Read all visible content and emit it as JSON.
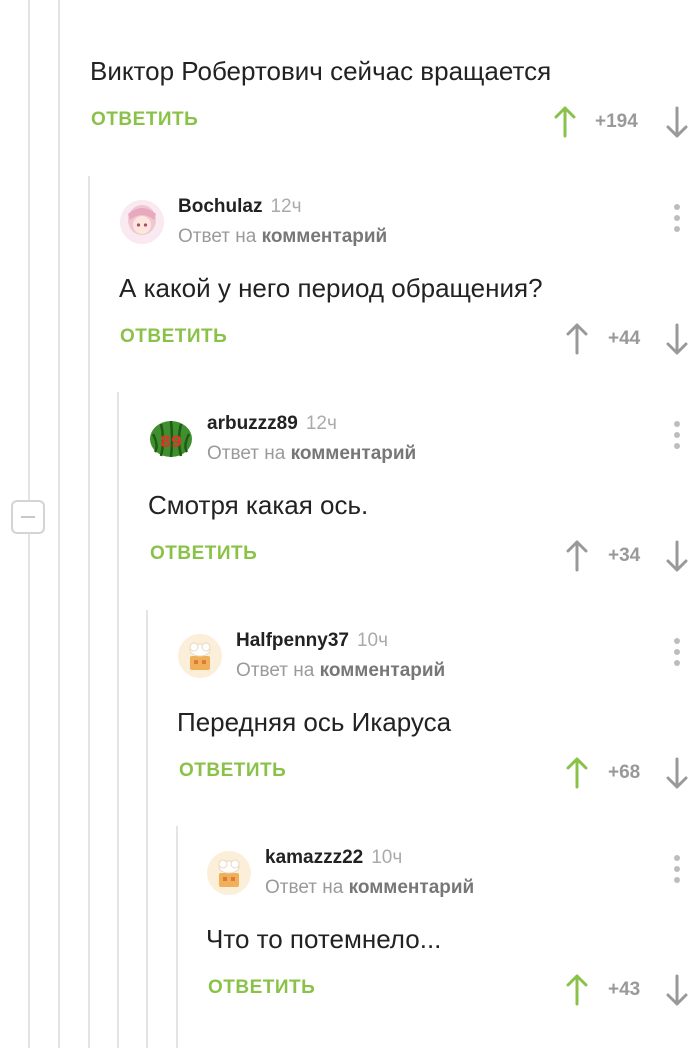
{
  "comments": [
    {
      "text": "Виктор Робертович сейчас вращается",
      "reply_label": "ОТВЕТИТЬ",
      "score": "+194",
      "upvoted": true
    },
    {
      "username": "Bochulaz",
      "time": "12ч",
      "reply_prefix": "Ответ на",
      "reply_target": "комментарий",
      "text": "А какой у него период обращения?",
      "reply_label": "ОТВЕТИТЬ",
      "score": "+44",
      "upvoted": false
    },
    {
      "username": "arbuzzz89",
      "time": "12ч",
      "reply_prefix": "Ответ на",
      "reply_target": "комментарий",
      "text": "Смотря какая ось.",
      "reply_label": "ОТВЕТИТЬ",
      "score": "+34",
      "upvoted": false,
      "avatar_badge": "89"
    },
    {
      "username": "Halfpenny37",
      "time": "10ч",
      "reply_prefix": "Ответ на",
      "reply_target": "комментарий",
      "text": "Передняя ось Икаруса",
      "reply_label": "ОТВЕТИТЬ",
      "score": "+68",
      "upvoted": true
    },
    {
      "username": "kamazzz22",
      "time": "10ч",
      "reply_prefix": "Ответ на",
      "reply_target": "комментарий",
      "text": "Что то потемнело...",
      "reply_label": "ОТВЕТИТЬ",
      "score": "+43",
      "upvoted": true
    }
  ],
  "colors": {
    "accent_green": "#8ac249",
    "muted": "#999999",
    "thread_line": "#e4e4e4"
  },
  "icons": {
    "upvote": "arrow-up-icon",
    "downvote": "arrow-down-icon",
    "menu": "more-vertical-icon",
    "collapse": "minus-icon"
  }
}
